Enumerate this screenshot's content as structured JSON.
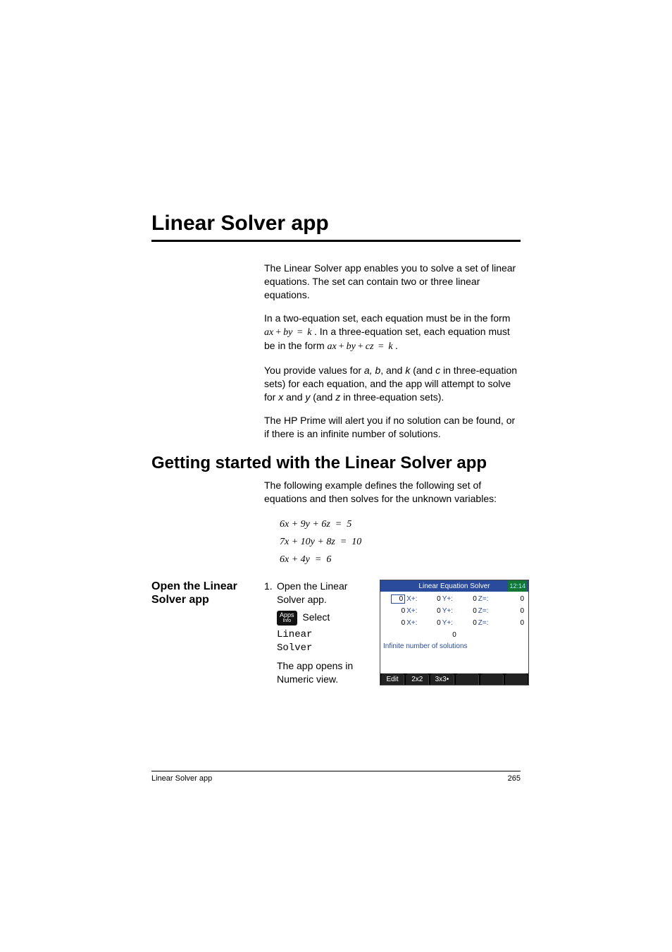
{
  "chapter_title": "Linear Solver app",
  "intro_p1": "The Linear Solver app enables you to solve a set of linear equations. The set can contain two or three linear equations.",
  "intro_p2_a": "In a two-equation set, each equation must be in the form ",
  "intro_p2_eq1_a": "ax",
  "intro_p2_eq1_b": "by",
  "intro_p2_eq1_k": "k",
  "intro_p2_b": ". In a three-equation set, each equation must be in the form ",
  "intro_p2_eq2_a": "ax",
  "intro_p2_eq2_b": "by",
  "intro_p2_eq2_c": "cz",
  "intro_p2_eq2_k": "k",
  "intro_p2_c": ".",
  "intro_p3_a": "You provide values for ",
  "intro_p3_vars1": "a, b",
  "intro_p3_b": ", and ",
  "intro_p3_vars2": "k",
  "intro_p3_c": " (and ",
  "intro_p3_vars3": "c",
  "intro_p3_d": " in three-equation sets) for each equation, and the app will attempt to solve for ",
  "intro_p3_vars4": "x",
  "intro_p3_e": " and ",
  "intro_p3_vars5": "y",
  "intro_p3_f": " (and ",
  "intro_p3_vars6": "z",
  "intro_p3_g": " in three-equation sets).",
  "intro_p4": "The HP Prime will alert you if no solution can be found, or if there is an infinite number of solutions.",
  "section_title": "Getting started with the Linear Solver app",
  "section_intro": "The following example defines the following set of equations and then solves for the unknown variables:",
  "equations": {
    "eq1": "6x + 9y + 6z  =  5",
    "eq2": "7x + 10y + 8z  =  10",
    "eq3": "6x + 4y  =  6"
  },
  "side_heading": "Open the Linear Solver app",
  "step1_num": "1.",
  "step1_text": "Open the Linear Solver app.",
  "apps_key_top": "Apps",
  "apps_key_bottom": "Info",
  "step1_select": "Select",
  "step1_mono1": "Linear",
  "step1_mono2": "Solver",
  "step1_after": "The app opens in Numeric view.",
  "calc": {
    "title": "Linear Equation Solver",
    "time": "12:14",
    "labels": {
      "x": "X+:",
      "y": "Y+:",
      "z": "Z=:"
    },
    "rows": [
      {
        "x": "0",
        "y": "0",
        "z": "0",
        "k": "0"
      },
      {
        "x": "0",
        "y": "0",
        "z": "0",
        "k": "0"
      },
      {
        "x": "0",
        "y": "0",
        "z": "0",
        "k": "0"
      }
    ],
    "answer_row": "0",
    "status": "Infinite number of solutions",
    "softkeys": [
      "Edit",
      "2x2",
      "3x3•",
      "",
      "",
      ""
    ]
  },
  "footer_left": "Linear Solver app",
  "footer_right": "265"
}
